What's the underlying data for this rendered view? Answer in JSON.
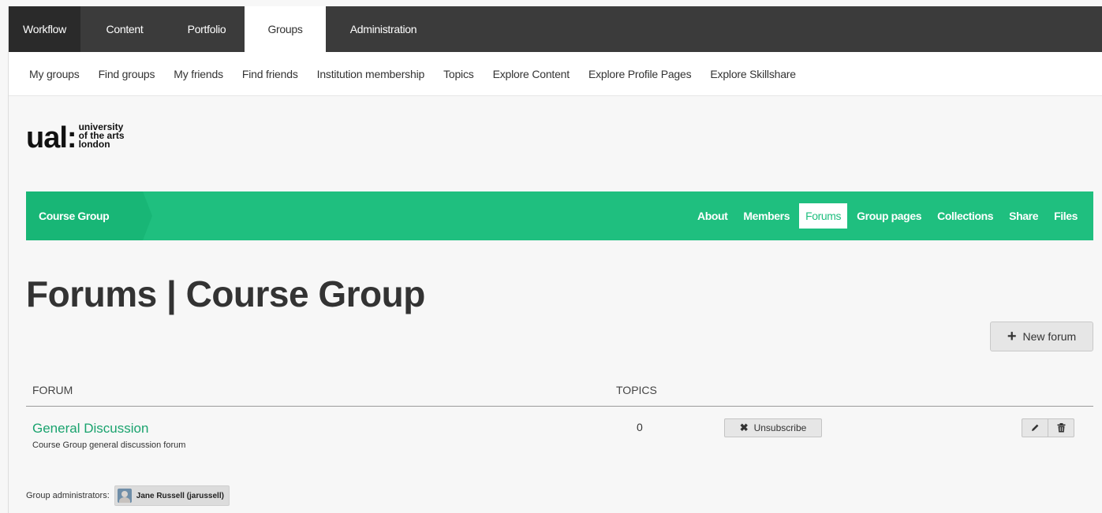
{
  "top_nav": {
    "tabs": [
      "Workflow",
      "Content",
      "Portfolio",
      "Groups",
      "Administration"
    ],
    "active": "Groups"
  },
  "sub_nav": {
    "items": [
      "My groups",
      "Find groups",
      "My friends",
      "Find friends",
      "Institution membership",
      "Topics",
      "Explore Content",
      "Explore Profile Pages",
      "Explore Skillshare"
    ]
  },
  "logo": {
    "mark": "ual:",
    "line1": "university",
    "line2": "of the arts",
    "line3": "london"
  },
  "group_bar": {
    "crumb": "Course Group",
    "nav": [
      "About",
      "Members",
      "Forums",
      "Group pages",
      "Collections",
      "Share",
      "Files"
    ],
    "active": "Forums",
    "color": "#1fbf7f"
  },
  "page": {
    "title": "Forums | Course Group",
    "new_forum_label": "New forum"
  },
  "table": {
    "headers": [
      "FORUM",
      "TOPICS"
    ],
    "rows": [
      {
        "name": "General Discussion",
        "description": "Course Group general discussion forum",
        "topics": "0",
        "unsubscribe_label": "Unsubscribe"
      }
    ]
  },
  "admins": {
    "label": "Group administrators:",
    "user": "Jane Russell (jarussell)"
  }
}
